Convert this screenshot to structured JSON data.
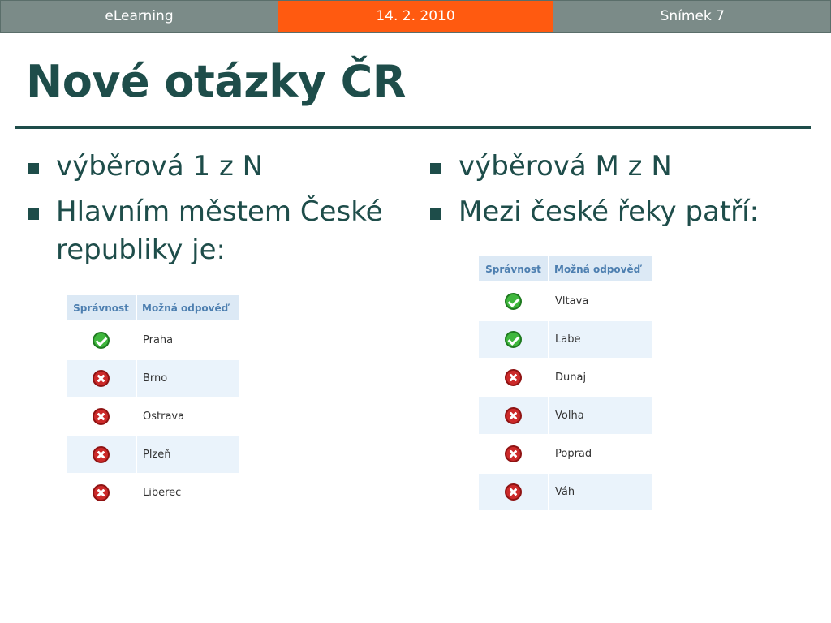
{
  "header": {
    "left_text": "eLearning",
    "center_text": "14. 2. 2010",
    "right_text": "Snímek 7",
    "colors": {
      "side_bg": "#7b8b88",
      "center_bg": "#ff5a10"
    }
  },
  "slide": {
    "title": "Nové otázky ČR",
    "title_color": "#1e4d4a"
  },
  "left_column": {
    "bullets": [
      {
        "text": "výběrová 1 z N"
      },
      {
        "text": "Hlavním městem České republiky je:"
      }
    ],
    "table": {
      "headers": {
        "correctness": "Správnost",
        "answer": "Možná odpověď"
      },
      "rows": [
        {
          "correct": true,
          "icon": "check-icon",
          "answer": "Praha"
        },
        {
          "correct": false,
          "icon": "cross-icon",
          "answer": "Brno"
        },
        {
          "correct": false,
          "icon": "cross-icon",
          "answer": "Ostrava"
        },
        {
          "correct": false,
          "icon": "cross-icon",
          "answer": "Plzeň"
        },
        {
          "correct": false,
          "icon": "cross-icon",
          "answer": "Liberec"
        }
      ]
    }
  },
  "right_column": {
    "bullets": [
      {
        "text": "výběrová M z N"
      },
      {
        "text": "Mezi české řeky patří:"
      }
    ],
    "table": {
      "headers": {
        "correctness": "Správnost",
        "answer": "Možná odpověď"
      },
      "rows": [
        {
          "correct": true,
          "icon": "check-icon",
          "answer": "Vltava"
        },
        {
          "correct": true,
          "icon": "check-icon",
          "answer": "Labe"
        },
        {
          "correct": false,
          "icon": "cross-icon",
          "answer": "Dunaj"
        },
        {
          "correct": false,
          "icon": "cross-icon",
          "answer": "Volha"
        },
        {
          "correct": false,
          "icon": "cross-icon",
          "answer": "Poprad"
        },
        {
          "correct": false,
          "icon": "cross-icon",
          "answer": "Váh"
        }
      ]
    }
  }
}
